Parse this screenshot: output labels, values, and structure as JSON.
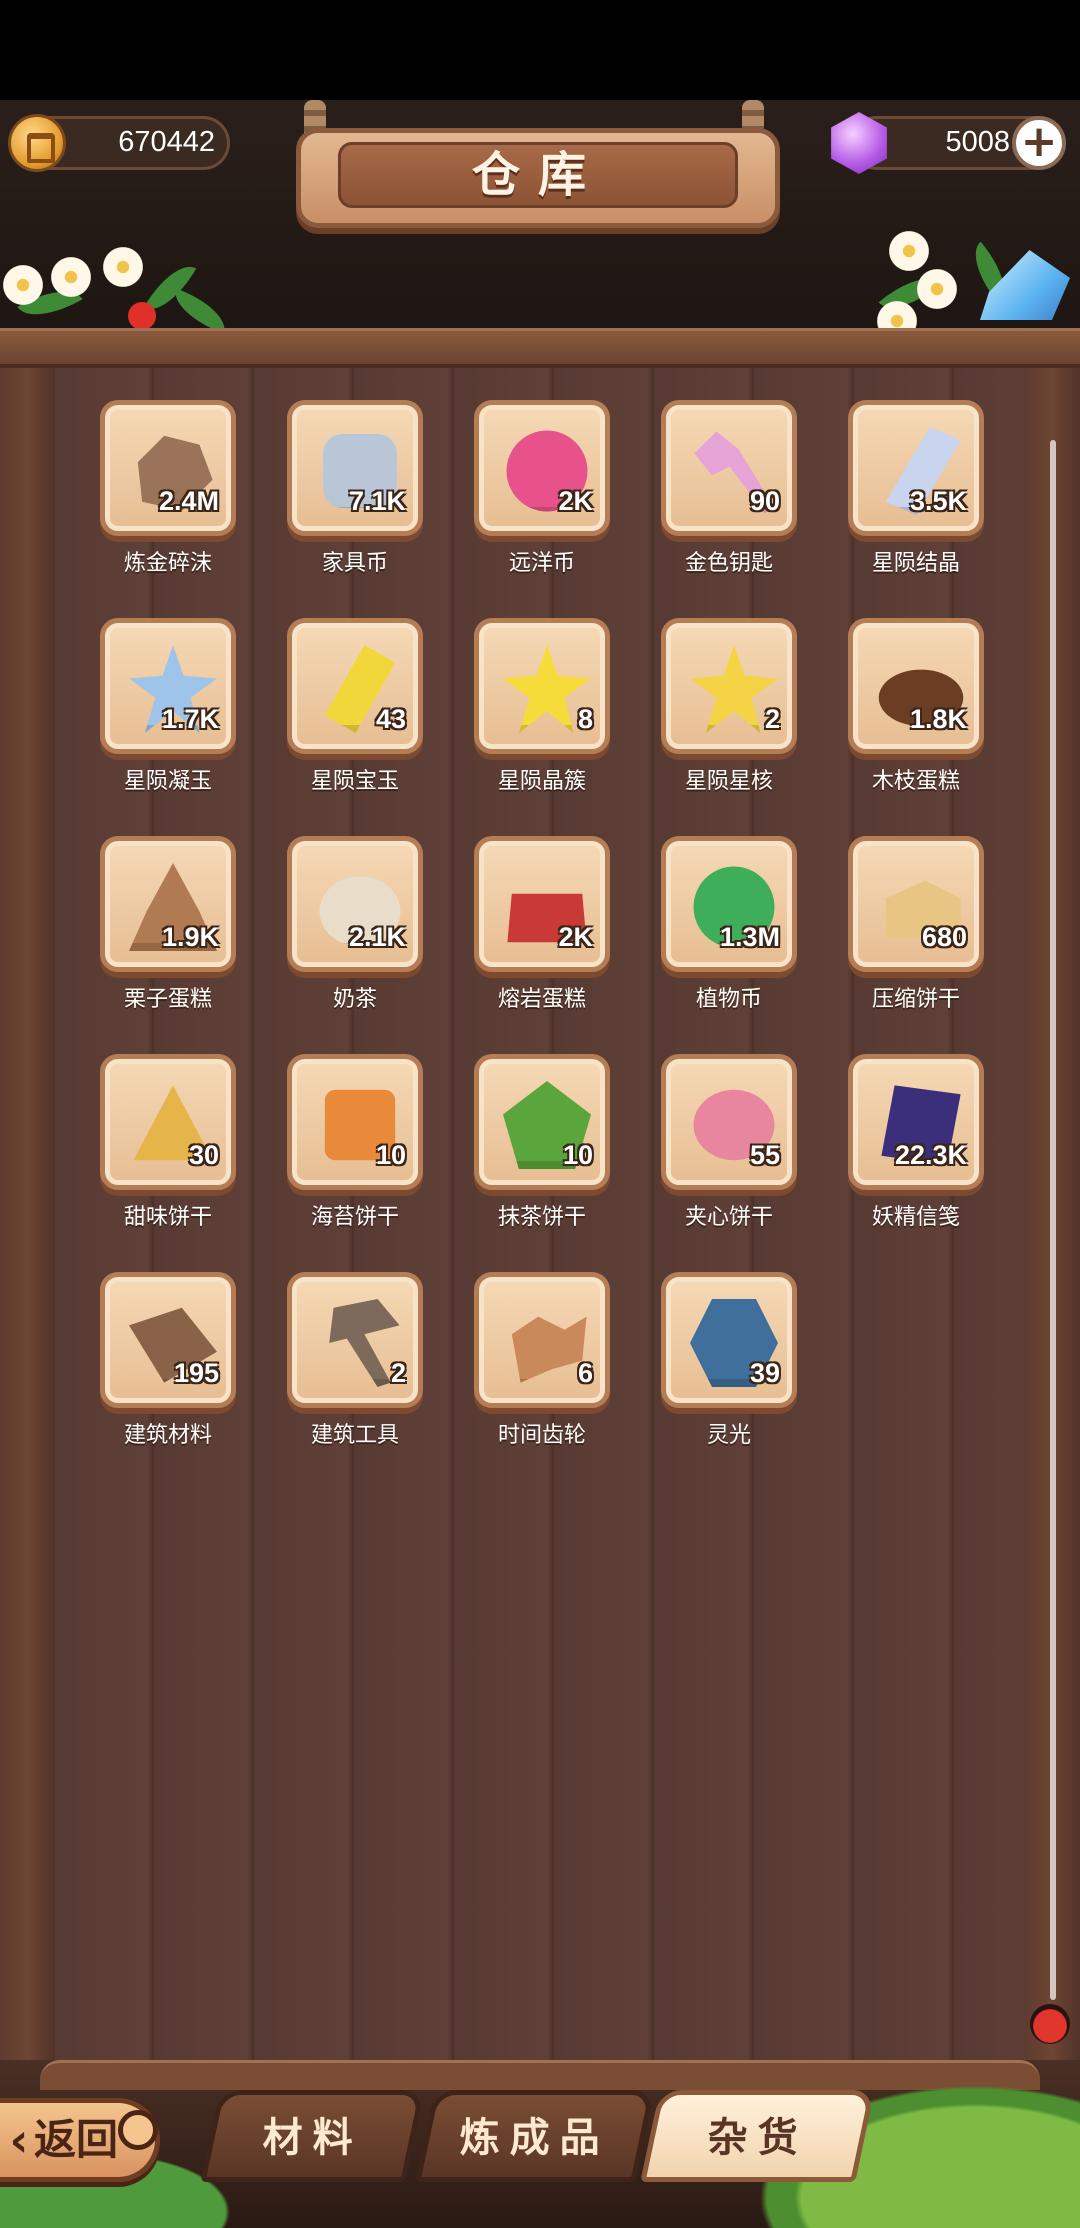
{
  "header": {
    "title": "仓库",
    "gold": {
      "icon": "gold-coin-icon",
      "value": "670442"
    },
    "gems": {
      "icon": "purple-gem-icon",
      "value": "5008",
      "add_label": "+"
    }
  },
  "items": [
    {
      "name": "炼金碎沫",
      "count": "2.4M",
      "icon": "alchemy-fragments-icon",
      "color": "#9a7358"
    },
    {
      "name": "家具币",
      "count": "7.1K",
      "icon": "furniture-coin-icon",
      "color": "#b9c6d8"
    },
    {
      "name": "远洋币",
      "count": "2K",
      "icon": "ocean-coin-icon",
      "color": "#e8528a"
    },
    {
      "name": "金色钥匙",
      "count": "90",
      "icon": "golden-key-icon",
      "color": "#e6a4d6"
    },
    {
      "name": "星陨结晶",
      "count": "3.5K",
      "icon": "meteor-crystal-icon",
      "color": "#c9d4ef"
    },
    {
      "name": "星陨凝玉",
      "count": "1.7K",
      "icon": "meteor-jade-icon",
      "color": "#9ec4ea"
    },
    {
      "name": "星陨宝玉",
      "count": "43",
      "icon": "meteor-gem-icon",
      "color": "#f2d73a"
    },
    {
      "name": "星陨晶簇",
      "count": "8",
      "icon": "meteor-cluster-icon",
      "color": "#f5dc3a"
    },
    {
      "name": "星陨星核",
      "count": "2",
      "icon": "meteor-core-icon",
      "color": "#f4d444"
    },
    {
      "name": "木枝蛋糕",
      "count": "1.8K",
      "icon": "log-cake-icon",
      "color": "#6b3d22"
    },
    {
      "name": "栗子蛋糕",
      "count": "1.9K",
      "icon": "chestnut-cake-icon",
      "color": "#b07a52"
    },
    {
      "name": "奶茶",
      "count": "2.1K",
      "icon": "milk-tea-icon",
      "color": "#e9dcc8"
    },
    {
      "name": "熔岩蛋糕",
      "count": "2K",
      "icon": "lava-cake-icon",
      "color": "#c93a36"
    },
    {
      "name": "植物币",
      "count": "1.3M",
      "icon": "plant-coin-icon",
      "color": "#3eae5a"
    },
    {
      "name": "压缩饼干",
      "count": "680",
      "icon": "compressed-biscuit-icon",
      "color": "#e9c584"
    },
    {
      "name": "甜味饼干",
      "count": "30",
      "icon": "sweet-cracker-icon",
      "color": "#e6b54a"
    },
    {
      "name": "海苔饼干",
      "count": "10",
      "icon": "seaweed-cracker-icon",
      "color": "#e88a3a"
    },
    {
      "name": "抹茶饼干",
      "count": "10",
      "icon": "matcha-cookie-icon",
      "color": "#5aa63c"
    },
    {
      "name": "夹心饼干",
      "count": "55",
      "icon": "sandwich-cookie-icon",
      "color": "#e886a0"
    },
    {
      "name": "妖精信笺",
      "count": "22.3K",
      "icon": "fairy-letter-icon",
      "color": "#3b2e7a"
    },
    {
      "name": "建筑材料",
      "count": "195",
      "icon": "building-materials-icon",
      "color": "#8a6247"
    },
    {
      "name": "建筑工具",
      "count": "2",
      "icon": "building-tools-icon",
      "color": "#7d6a5a"
    },
    {
      "name": "时间齿轮",
      "count": "6",
      "icon": "time-gears-icon",
      "color": "#c9895a"
    },
    {
      "name": "灵光",
      "count": "39",
      "icon": "inspiration-icon",
      "color": "#3f6f9a"
    }
  ],
  "bottom": {
    "back_label": "返回",
    "tabs": [
      {
        "label": "材料",
        "active": false
      },
      {
        "label": "炼成品",
        "active": false
      },
      {
        "label": "杂货",
        "active": true
      }
    ]
  },
  "colors": {
    "board": "#573a33",
    "tile": "#f5d9b6",
    "tile_border": "#b57d56",
    "active_tab": "#fff1dc"
  }
}
